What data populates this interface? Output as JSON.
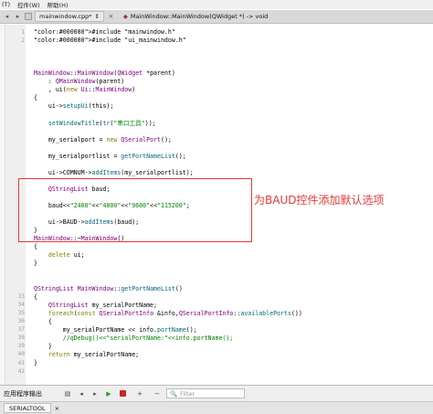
{
  "menubar": {
    "items": [
      "(T)",
      "控件(W)",
      "帮助(H)"
    ]
  },
  "tabbar": {
    "nav_back": "◂",
    "nav_forward": "▸",
    "file_label": "mainwindow.cpp*",
    "close_glyph": "×",
    "func_label": "MainWindow::MainWindow(QWidget *) -> void"
  },
  "gutter": {
    "numbers": [
      "1",
      "2",
      "",
      "",
      "",
      "",
      "",
      "",
      "",
      "",
      "",
      "",
      "",
      "",
      "",
      "",
      "",
      "",
      "",
      "",
      "",
      "",
      "",
      "",
      "",
      "",
      "",
      "",
      "",
      "",
      "",
      "",
      "33",
      "34",
      "35",
      "36",
      "37",
      "38",
      "39",
      "40",
      "41",
      "42"
    ],
    "markers": [
      "",
      "",
      "",
      "",
      "",
      "",
      "",
      "",
      "",
      "",
      "",
      "",
      "",
      "",
      "",
      "",
      "",
      "",
      "",
      "",
      "",
      "",
      "",
      "",
      "",
      "",
      "",
      "",
      "",
      "",
      "",
      "",
      "",
      "",
      "",
      "",
      "",
      "",
      "",
      "",
      "",
      ""
    ]
  },
  "code": {
    "lines": [
      "#include \"mainwindow.h\"",
      "#include \"ui_mainwindow.h\"",
      "",
      "",
      "",
      "MainWindow::MainWindow(QWidget *parent)",
      "    : QMainWindow(parent)",
      "    , ui(new Ui::MainWindow)",
      "{",
      "    ui->setupUi(this);",
      "",
      "    setWindowTitle(tr(\"串口工具\"));",
      "",
      "    my_serialport = new QSerialPort();",
      "",
      "    my_serialportlist = getPortNameList();",
      "",
      "    ui->COMNUM->addItems(my_serialportlist);",
      "",
      "    QStringList baud;",
      "",
      "    baud<<\"2400\"<<\"4800\"<<\"9600\"<<\"115200\";",
      "",
      "    ui->BAUD->addItems(baud);",
      "}",
      "MainWindow::~MainWindow()",
      "{",
      "    delete ui;",
      "}",
      "",
      "",
      "QStringList MainWindow::getPortNameList()",
      "{",
      "    QStringList my_serialPortName;",
      "    foreach(const QSerialPortInfo &info,QSerialPortInfo::availablePorts())",
      "    {",
      "        my_serialPortName << info.portName();",
      "        //qDebug()<<\"serialPortName:\"<<info.portName();",
      "    }",
      "    return my_serialPortName;",
      "}",
      ""
    ]
  },
  "annotation": {
    "text": "为BAUD控件添加默认选项"
  },
  "panel": {
    "title": "应用程序输出",
    "filter_placeholder": "Filter",
    "search_glyph": "🔍",
    "zoom_in": "+",
    "zoom_out": "−"
  },
  "output_tabs": [
    "SERIALTOOL"
  ],
  "colors": {
    "keyword": "#808000",
    "preprocessor": "#000080",
    "type": "#800080",
    "string": "#008000",
    "comment": "#008000",
    "annotation_red": "#e53935"
  }
}
